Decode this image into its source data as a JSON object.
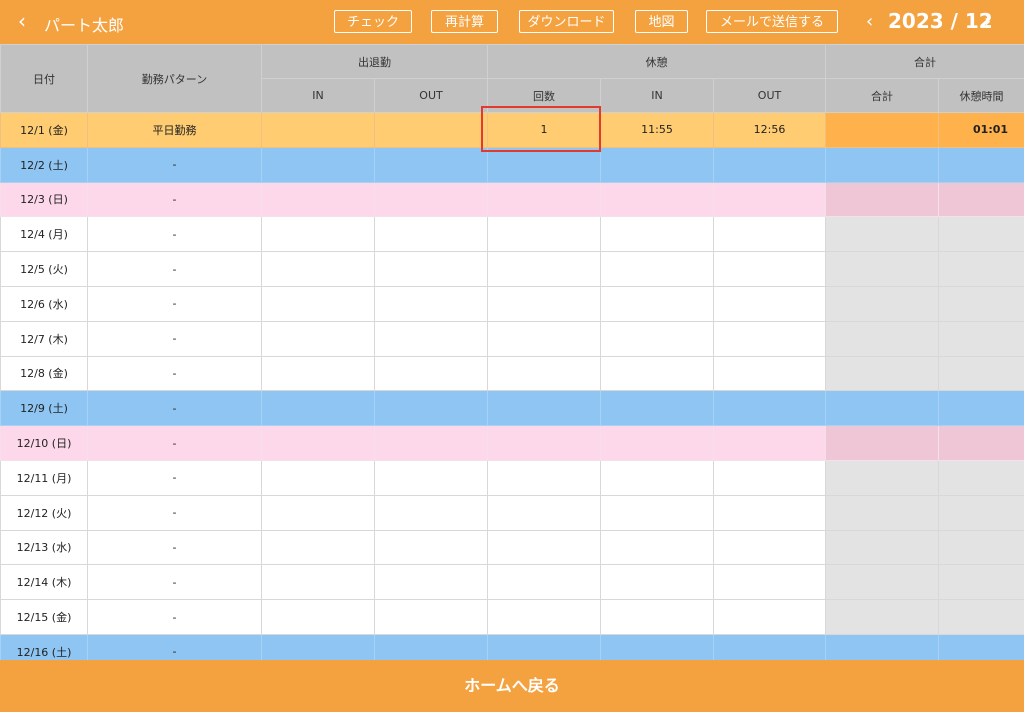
{
  "header": {
    "back_icon": "‹",
    "user_name": "パート太郎",
    "buttons": {
      "check": "チェック",
      "recalc": "再計算",
      "download": "ダウンロード",
      "map": "地図",
      "send_mail": "メールで送信する"
    },
    "prev_icon": "‹",
    "next_icon": "›",
    "month_label": "2023 / 12"
  },
  "table": {
    "headers": {
      "date": "日付",
      "pattern": "勤務パターン",
      "attendance": "出退勤",
      "break": "休憩",
      "total": "合計",
      "in": "IN",
      "out": "OUT",
      "count": "回数",
      "break_in": "IN",
      "break_out": "OUT",
      "total_sub": "合計",
      "break_time": "休憩時間"
    },
    "rows": [
      {
        "date": "12/1 (金)",
        "pattern": "平日勤務",
        "type": "today",
        "in": "",
        "out": "",
        "count": "1",
        "break_in": "11:55",
        "break_out": "12:56",
        "total": "",
        "break_time": "01:01"
      },
      {
        "date": "12/2 (土)",
        "pattern": "-",
        "type": "sat",
        "in": "",
        "out": "",
        "count": "",
        "break_in": "",
        "break_out": "",
        "total": "",
        "break_time": ""
      },
      {
        "date": "12/3 (日)",
        "pattern": "-",
        "type": "sun",
        "in": "",
        "out": "",
        "count": "",
        "break_in": "",
        "break_out": "",
        "total": "",
        "break_time": ""
      },
      {
        "date": "12/4 (月)",
        "pattern": "-",
        "type": "weekday",
        "in": "",
        "out": "",
        "count": "",
        "break_in": "",
        "break_out": "",
        "total": "",
        "break_time": ""
      },
      {
        "date": "12/5 (火)",
        "pattern": "-",
        "type": "weekday",
        "in": "",
        "out": "",
        "count": "",
        "break_in": "",
        "break_out": "",
        "total": "",
        "break_time": ""
      },
      {
        "date": "12/6 (水)",
        "pattern": "-",
        "type": "weekday",
        "in": "",
        "out": "",
        "count": "",
        "break_in": "",
        "break_out": "",
        "total": "",
        "break_time": ""
      },
      {
        "date": "12/7 (木)",
        "pattern": "-",
        "type": "weekday",
        "in": "",
        "out": "",
        "count": "",
        "break_in": "",
        "break_out": "",
        "total": "",
        "break_time": ""
      },
      {
        "date": "12/8 (金)",
        "pattern": "-",
        "type": "weekday",
        "in": "",
        "out": "",
        "count": "",
        "break_in": "",
        "break_out": "",
        "total": "",
        "break_time": ""
      },
      {
        "date": "12/9 (土)",
        "pattern": "-",
        "type": "sat",
        "in": "",
        "out": "",
        "count": "",
        "break_in": "",
        "break_out": "",
        "total": "",
        "break_time": ""
      },
      {
        "date": "12/10 (日)",
        "pattern": "-",
        "type": "sun",
        "in": "",
        "out": "",
        "count": "",
        "break_in": "",
        "break_out": "",
        "total": "",
        "break_time": ""
      },
      {
        "date": "12/11 (月)",
        "pattern": "-",
        "type": "weekday",
        "in": "",
        "out": "",
        "count": "",
        "break_in": "",
        "break_out": "",
        "total": "",
        "break_time": ""
      },
      {
        "date": "12/12 (火)",
        "pattern": "-",
        "type": "weekday",
        "in": "",
        "out": "",
        "count": "",
        "break_in": "",
        "break_out": "",
        "total": "",
        "break_time": ""
      },
      {
        "date": "12/13 (水)",
        "pattern": "-",
        "type": "weekday",
        "in": "",
        "out": "",
        "count": "",
        "break_in": "",
        "break_out": "",
        "total": "",
        "break_time": ""
      },
      {
        "date": "12/14 (木)",
        "pattern": "-",
        "type": "weekday",
        "in": "",
        "out": "",
        "count": "",
        "break_in": "",
        "break_out": "",
        "total": "",
        "break_time": ""
      },
      {
        "date": "12/15 (金)",
        "pattern": "-",
        "type": "weekday",
        "in": "",
        "out": "",
        "count": "",
        "break_in": "",
        "break_out": "",
        "total": "",
        "break_time": ""
      },
      {
        "date": "12/16 (土)",
        "pattern": "-",
        "type": "sat",
        "in": "",
        "out": "",
        "count": "",
        "break_in": "",
        "break_out": "",
        "total": "",
        "break_time": ""
      }
    ]
  },
  "footer": {
    "home_label": "ホームへ戻る"
  },
  "colors": {
    "brand": "#f4a240",
    "saturday": "#8ec5f2",
    "sunday": "#fdd8ea",
    "today": "#ffcc72",
    "highlight": "#e23b2e"
  }
}
